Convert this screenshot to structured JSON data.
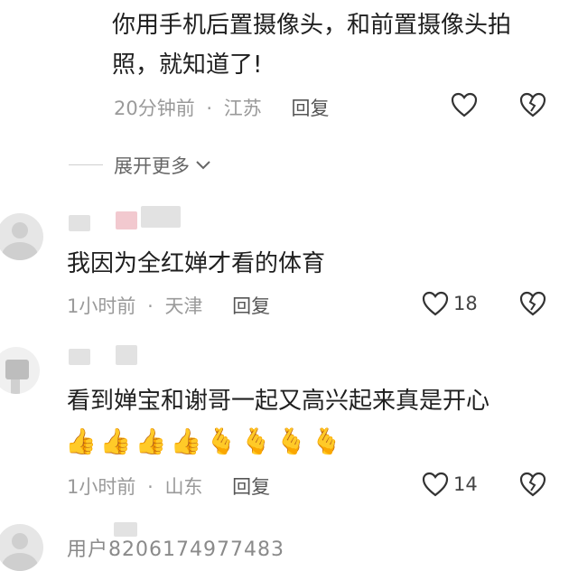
{
  "comment0": {
    "text_line1": "你用手机后置摄像头，和前置摄像头拍",
    "text_line2": "照，就知道了!",
    "time": "20分钟前",
    "location": "江苏",
    "reply": "回复",
    "separator": "·"
  },
  "expand": {
    "label": "展开更多"
  },
  "comment1": {
    "text": "我因为全红婵才看的体育",
    "time": "1小时前",
    "location": "天津",
    "reply": "回复",
    "separator": "·",
    "likes": "18"
  },
  "comment2": {
    "text": "看到婵宝和谢哥一起又高兴起来真是开心",
    "emojis": [
      "👍",
      "👍",
      "👍",
      "👍",
      "🫰",
      "🫰",
      "🫰",
      "🫰"
    ],
    "time": "1小时前",
    "location": "山东",
    "reply": "回复",
    "separator": "·",
    "likes": "14"
  },
  "comment3": {
    "username": "用户8206174977483"
  },
  "icons": {
    "like": "heart-outline-icon",
    "dislike": "broken-heart-icon",
    "chevron": "chevron-down-icon"
  }
}
